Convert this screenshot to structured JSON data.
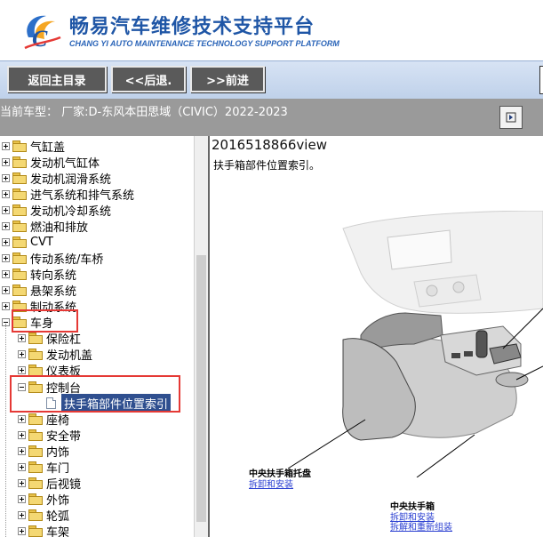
{
  "header": {
    "title_cn": "畅易汽车维修技术支持平台",
    "title_en": "CHANG YI AUTO MAINTENANCE TECHNOLOGY SUPPORT PLATFORM"
  },
  "toolbar": {
    "home_label": "返回主目录",
    "back_label": "<<后退.",
    "forward_label": ">>前进"
  },
  "vehicle": {
    "text": "当前车型： 厂家:D-东风本田思域（CIVIC）2022-2023"
  },
  "tree": {
    "top": [
      {
        "label": "气缸盖"
      },
      {
        "label": "发动机气缸体"
      },
      {
        "label": "发动机润滑系统"
      },
      {
        "label": "进气系统和排气系统"
      },
      {
        "label": "发动机冷却系统"
      },
      {
        "label": "燃油和排放"
      },
      {
        "label": "CVT"
      },
      {
        "label": "传动系统/车桥"
      },
      {
        "label": "转向系统"
      },
      {
        "label": "悬架系统"
      },
      {
        "label": "制动系统"
      }
    ],
    "body": {
      "label": "车身"
    },
    "body_children_a": [
      {
        "label": "保险杠"
      },
      {
        "label": "发动机盖"
      },
      {
        "label": "仪表板"
      }
    ],
    "console": {
      "label": "控制台"
    },
    "selected": {
      "label": "扶手箱部件位置索引"
    },
    "body_children_b": [
      {
        "label": "座椅"
      },
      {
        "label": "安全带"
      },
      {
        "label": "内饰"
      },
      {
        "label": "车门"
      },
      {
        "label": "后视镜"
      },
      {
        "label": "外饰"
      },
      {
        "label": "轮弧"
      },
      {
        "label": "车架"
      }
    ]
  },
  "content": {
    "title": "2016518866view",
    "subtitle": "扶手箱部件位置索引。",
    "callouts": {
      "tray_label": "中央扶手箱托盘",
      "tray_link": "拆卸和安装",
      "armrest_label": "中央扶手箱",
      "armrest_link1": "拆卸和安装",
      "armrest_link2": "拆解和重新组装"
    }
  },
  "colors": {
    "brand_blue": "#1f56a6",
    "button_gray": "#5a5a5a",
    "highlight_red": "#e53935",
    "selection_navy": "#2f4f8f",
    "link_blue": "#2a3fd1"
  }
}
